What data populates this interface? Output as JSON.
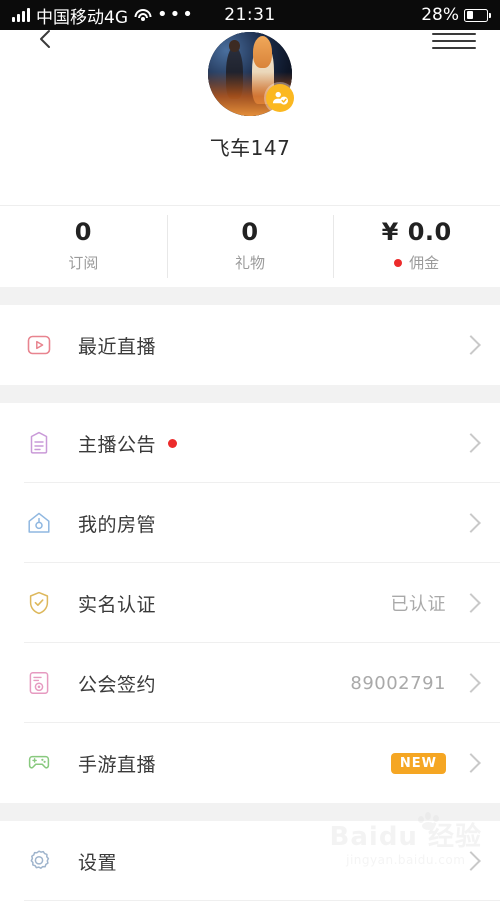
{
  "status_bar": {
    "carrier": "中国移动4G",
    "signal_icon": "signal-bars-icon",
    "wifi_icon": "wifi-icon",
    "more_icon": "ellipsis-icon",
    "time": "21:31",
    "battery_percent": "28%",
    "battery_icon": "battery-icon"
  },
  "nav": {
    "back_icon": "back-chevron-icon",
    "menu_icon": "hamburger-menu-icon"
  },
  "profile": {
    "avatar_icon": "user-avatar-image",
    "verified_icon": "verified-user-badge-icon",
    "username": "飞车147"
  },
  "stats": [
    {
      "value": "0",
      "label": "订阅",
      "has_dot": false
    },
    {
      "value": "0",
      "label": "礼物",
      "has_dot": false
    },
    {
      "value": "¥ 0.0",
      "label": "佣金",
      "has_dot": true
    }
  ],
  "sections": [
    {
      "rows": [
        {
          "icon": "play-video-icon",
          "label": "最近直播",
          "value": "",
          "badge": "",
          "label_dot": false,
          "chevron": "chevron-right-icon"
        }
      ]
    },
    {
      "rows": [
        {
          "icon": "clipboard-announcement-icon",
          "label": "主播公告",
          "value": "",
          "badge": "",
          "label_dot": true,
          "chevron": "chevron-right-icon"
        },
        {
          "icon": "house-room-manager-icon",
          "label": "我的房管",
          "value": "",
          "badge": "",
          "label_dot": false,
          "chevron": "chevron-right-icon"
        },
        {
          "icon": "shield-check-icon",
          "label": "实名认证",
          "value": "已认证",
          "badge": "",
          "label_dot": false,
          "chevron": "chevron-right-icon"
        },
        {
          "icon": "certificate-contract-icon",
          "label": "公会签约",
          "value": "89002791",
          "badge": "",
          "label_dot": false,
          "chevron": "chevron-right-icon"
        },
        {
          "icon": "gamepad-icon",
          "label": "手游直播",
          "value": "",
          "badge": "NEW",
          "label_dot": false,
          "chevron": "chevron-right-icon"
        }
      ]
    },
    {
      "rows": [
        {
          "icon": "gear-settings-icon",
          "label": "设置",
          "value": "",
          "badge": "",
          "label_dot": false,
          "chevron": "chevron-right-icon"
        }
      ]
    }
  ],
  "watermark": {
    "main": "Baidu 经验",
    "sub": "jingyan.baidu.com"
  },
  "colors": {
    "accent_red": "#ec2b2b",
    "badge_orange": "#f5a623",
    "verified_yellow": "#fbb821",
    "page_bg": "#f2f2f2",
    "card_bg": "#ffffff"
  }
}
